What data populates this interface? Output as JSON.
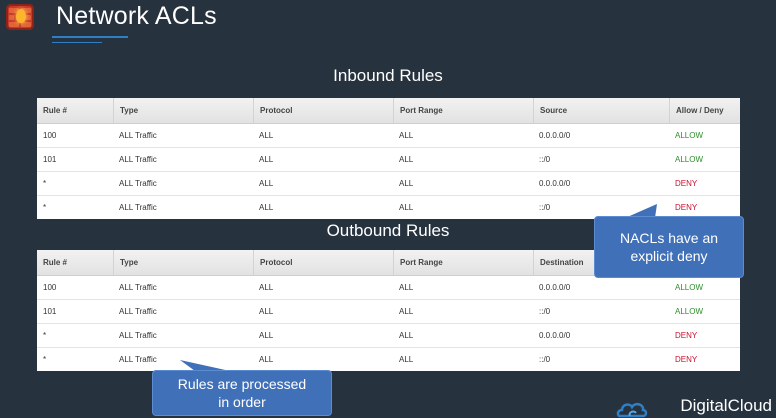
{
  "page_title": "Network ACLs",
  "inbound": {
    "title": "Inbound Rules",
    "headers": [
      "Rule #",
      "Type",
      "Protocol",
      "Port Range",
      "Source",
      "Allow / Deny"
    ],
    "rows": [
      [
        "100",
        "ALL Traffic",
        "ALL",
        "ALL",
        "0.0.0.0/0",
        "ALLOW"
      ],
      [
        "101",
        "ALL Traffic",
        "ALL",
        "ALL",
        "::/0",
        "ALLOW"
      ],
      [
        "*",
        "ALL Traffic",
        "ALL",
        "ALL",
        "0.0.0.0/0",
        "DENY"
      ],
      [
        "*",
        "ALL Traffic",
        "ALL",
        "ALL",
        "::/0",
        "DENY"
      ]
    ]
  },
  "outbound": {
    "title": "Outbound Rules",
    "headers": [
      "Rule #",
      "Type",
      "Protocol",
      "Port Range",
      "Destination",
      ""
    ],
    "rows": [
      [
        "100",
        "ALL Traffic",
        "ALL",
        "ALL",
        "0.0.0.0/0",
        "ALLOW"
      ],
      [
        "101",
        "ALL Traffic",
        "ALL",
        "ALL",
        "::/0",
        "ALLOW"
      ],
      [
        "*",
        "ALL Traffic",
        "ALL",
        "ALL",
        "0.0.0.0/0",
        "DENY"
      ],
      [
        "*",
        "ALL Traffic",
        "ALL",
        "ALL",
        "::/0",
        "DENY"
      ]
    ]
  },
  "callouts": {
    "deny_line1": "NACLs have an",
    "deny_line2": "explicit deny",
    "order_line1": "Rules are processed",
    "order_line2": "in order"
  },
  "brand": "DigitalCloud",
  "colors": {
    "allow": "#2a8f2a",
    "deny": "#c8102e",
    "accent": "#3f70b8"
  },
  "icons": {
    "logo": "firewall-icon",
    "brand": "cloud-icon"
  }
}
